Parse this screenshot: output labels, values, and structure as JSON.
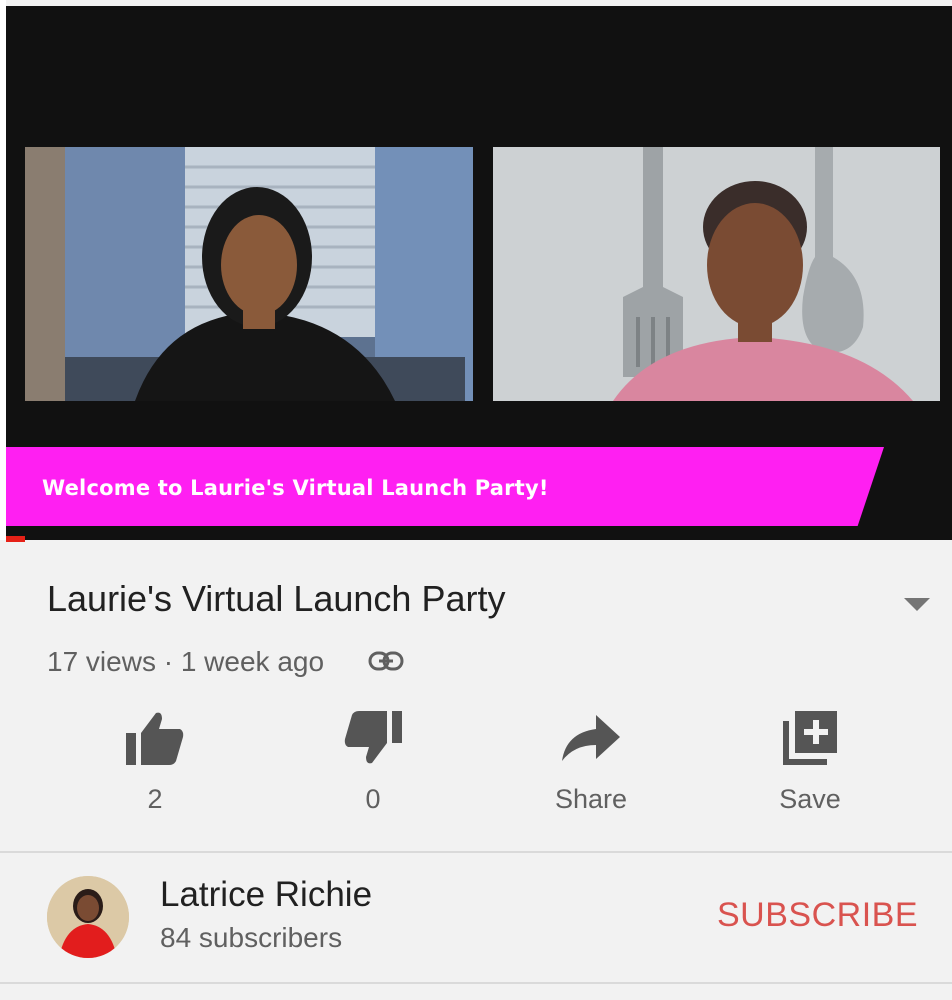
{
  "video": {
    "banner_text": "Welcome to Laurie's Virtual Launch Party!",
    "playback_progress": 0.02
  },
  "details": {
    "title": "Laurie's Virtual Launch Party",
    "views": "17 views",
    "separator": "·",
    "age": "1 week ago"
  },
  "actions": {
    "like_count": "2",
    "dislike_count": "0",
    "share_label": "Share",
    "save_label": "Save"
  },
  "channel": {
    "name": "Latrice Richie",
    "subscribers": "84 subscribers",
    "subscribe_label": "SUBSCRIBE"
  },
  "colors": {
    "banner": "#ff1ff2",
    "subscribe": "#d9534f",
    "progress": "#e62117",
    "icons": "#555555"
  },
  "icons": [
    "chevron-down-icon",
    "link-icon",
    "thumbs-up-icon",
    "thumbs-down-icon",
    "share-icon",
    "add-to-playlist-icon"
  ]
}
